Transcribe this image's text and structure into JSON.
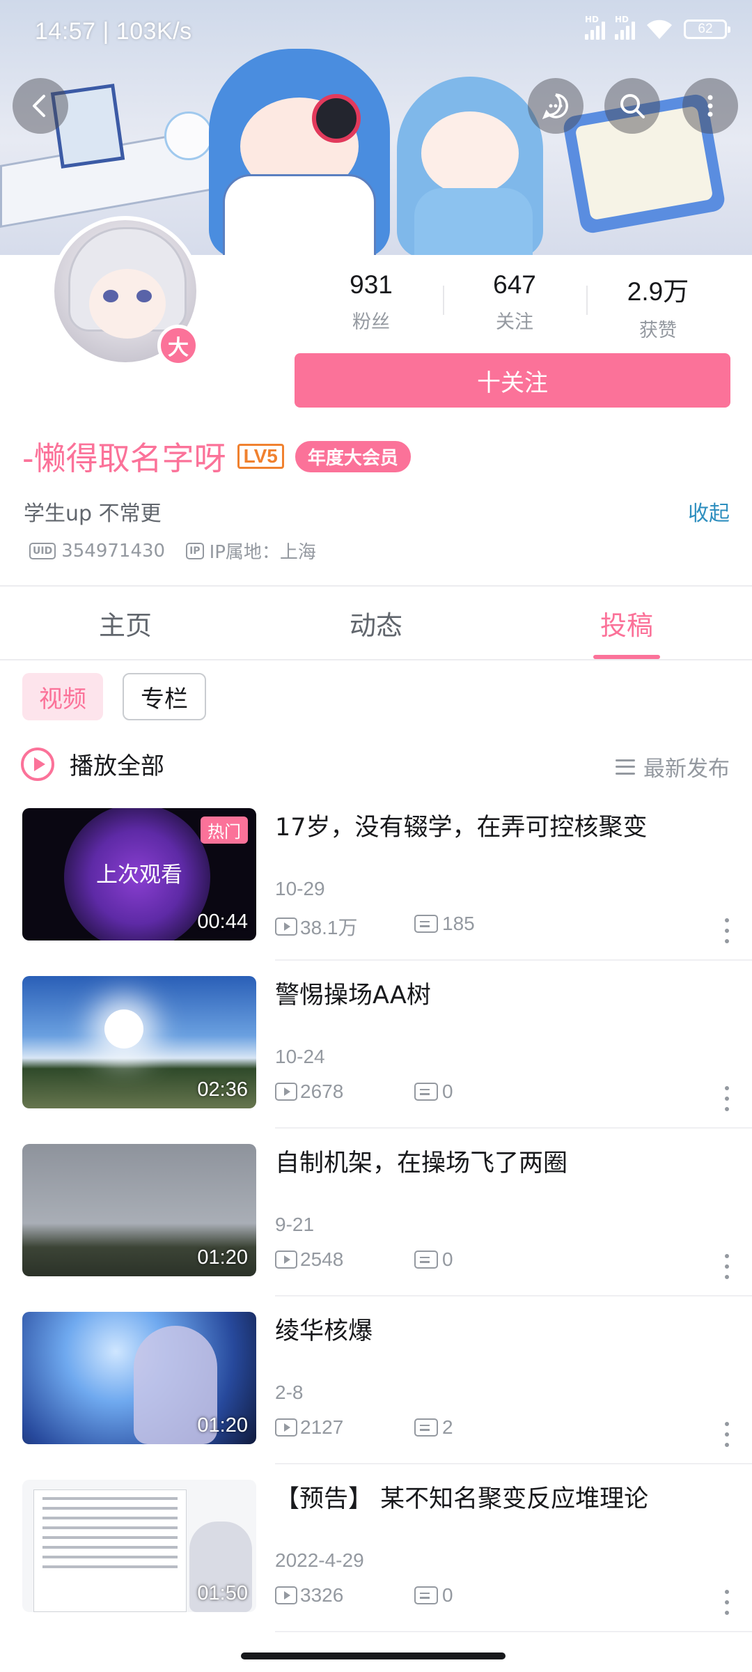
{
  "status_bar": {
    "time": "14:57 | 103K/s",
    "battery": "62",
    "signal_label": "HD"
  },
  "header": {
    "buttons": [
      "back-icon",
      "message-icon",
      "search-icon",
      "more-icon"
    ]
  },
  "profile": {
    "stats": [
      {
        "value": "931",
        "label": "粉丝"
      },
      {
        "value": "647",
        "label": "关注"
      },
      {
        "value": "2.9万",
        "label": "获赞"
      }
    ],
    "follow_label": "十关注",
    "badge_char": "大",
    "name": "-懒得取名字呀",
    "level": "LV5",
    "vip_tag": "年度大会员",
    "sign": "学生up 不常更",
    "collapse_label": "收起",
    "uid_icon": "UID",
    "uid": "354971430",
    "ip_icon": "IP",
    "ip": "IP属地：上海"
  },
  "tabs": [
    {
      "label": "主页",
      "active": false
    },
    {
      "label": "动态",
      "active": false
    },
    {
      "label": "投稿",
      "active": true
    }
  ],
  "subtabs": [
    {
      "label": "视频",
      "active": true
    },
    {
      "label": "专栏",
      "active": false
    }
  ],
  "list_header": {
    "play_all": "播放全部",
    "sort": "最新发布"
  },
  "videos": [
    {
      "title": "17岁，没有辍学，在弄可控核聚变",
      "date": "10-29",
      "plays": "38.1万",
      "comments": "185",
      "duration": "00:44",
      "badge": "热门",
      "overlay": "上次观看"
    },
    {
      "title": "警惕操场AA树",
      "date": "10-24",
      "plays": "2678",
      "comments": "0",
      "duration": "02:36"
    },
    {
      "title": "自制机架，在操场飞了两圈",
      "date": "9-21",
      "plays": "2548",
      "comments": "0",
      "duration": "01:20"
    },
    {
      "title": "绫华核爆",
      "date": "2-8",
      "plays": "2127",
      "comments": "2",
      "duration": "01:20"
    },
    {
      "title": "【预告】 某不知名聚变反应堆理论",
      "date": "2022-4-29",
      "plays": "3326",
      "comments": "0",
      "duration": "01:50"
    }
  ],
  "colors": {
    "accent": "#fb7299",
    "link": "#2f8fbf",
    "level": "#f0812f",
    "muted": "#9499a0"
  }
}
